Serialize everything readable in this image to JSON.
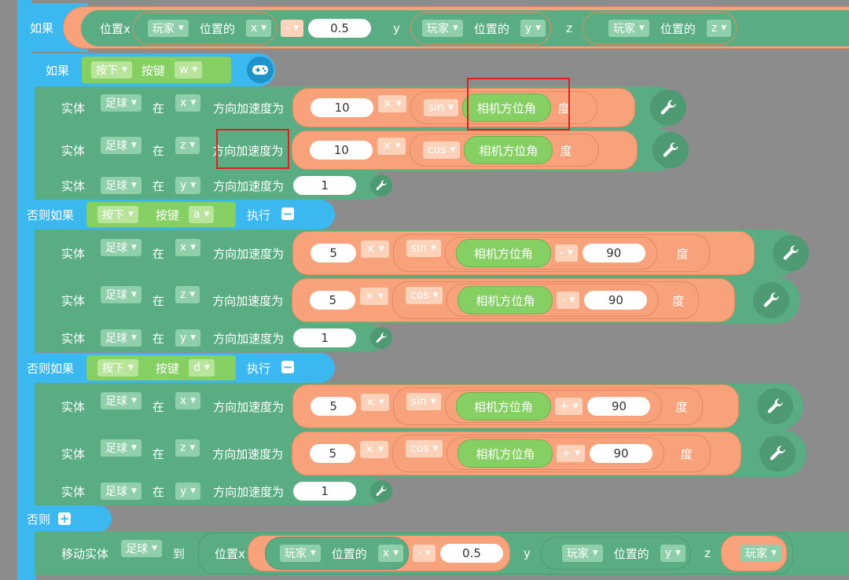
{
  "header": {
    "if_label": "如果",
    "pos_label": "位置x",
    "player": "玩家",
    "pos_of": "位置的",
    "x": "x",
    "minus": "-",
    "offset": "0.5",
    "y": "y",
    "z": "z"
  },
  "inner_if": {
    "if_label": "如果",
    "press": "按下",
    "key_label": "按键",
    "key": "w"
  },
  "rows_w": [
    {
      "entity": "实体",
      "obj": "足球",
      "at": "在",
      "axis": "x",
      "accel": "方向加速度为",
      "num": "10",
      "mul": "×",
      "fn": "sin",
      "cam": "相机方位角",
      "deg": "度"
    },
    {
      "entity": "实体",
      "obj": "足球",
      "at": "在",
      "axis": "z",
      "accel": "方向加速度为",
      "num": "10",
      "mul": "×",
      "fn": "cos",
      "cam": "相机方位角",
      "deg": "度"
    },
    {
      "entity": "实体",
      "obj": "足球",
      "at": "在",
      "axis": "y",
      "accel": "方向加速度为",
      "num": "1"
    }
  ],
  "elseif_a": {
    "label": "否则如果",
    "press": "按下",
    "key_label": "按键",
    "key": "a",
    "exec": "执行"
  },
  "rows_a": [
    {
      "entity": "实体",
      "obj": "足球",
      "at": "在",
      "axis": "x",
      "accel": "方向加速度为",
      "num": "5",
      "mul": "×",
      "fn": "sin",
      "cam": "相机方位角",
      "op": "-",
      "val": "90",
      "deg": "度"
    },
    {
      "entity": "实体",
      "obj": "足球",
      "at": "在",
      "axis": "z",
      "accel": "方向加速度为",
      "num": "5",
      "mul": "×",
      "fn": "cos",
      "cam": "相机方位角",
      "op": "-",
      "val": "90",
      "deg": "度"
    },
    {
      "entity": "实体",
      "obj": "足球",
      "at": "在",
      "axis": "y",
      "accel": "方向加速度为",
      "num": "1"
    }
  ],
  "elseif_d": {
    "label": "否则如果",
    "press": "按下",
    "key_label": "按键",
    "key": "d",
    "exec": "执行"
  },
  "rows_d": [
    {
      "entity": "实体",
      "obj": "足球",
      "at": "在",
      "axis": "x",
      "accel": "方向加速度为",
      "num": "5",
      "mul": "×",
      "fn": "sin",
      "cam": "相机方位角",
      "op": "+",
      "val": "90",
      "deg": "度"
    },
    {
      "entity": "实体",
      "obj": "足球",
      "at": "在",
      "axis": "z",
      "accel": "方向加速度为",
      "num": "5",
      "mul": "×",
      "fn": "cos",
      "cam": "相机方位角",
      "op": "+",
      "val": "90",
      "deg": "度"
    },
    {
      "entity": "实体",
      "obj": "足球",
      "at": "在",
      "axis": "y",
      "accel": "方向加速度为",
      "num": "1"
    }
  ],
  "else": {
    "label": "否则"
  },
  "move": {
    "label": "移动实体",
    "obj": "足球",
    "to": "到",
    "pos_label": "位置x",
    "player": "玩家",
    "pos_of": "位置的",
    "x": "x",
    "minus": "-",
    "offset": "0.5",
    "y": "y",
    "z": "z"
  },
  "colors": {
    "control": "#3cb8f0",
    "entity": "#5aad82",
    "math": "#f7a27a",
    "sensor": "#86cf63",
    "highlight": "#e02020"
  }
}
